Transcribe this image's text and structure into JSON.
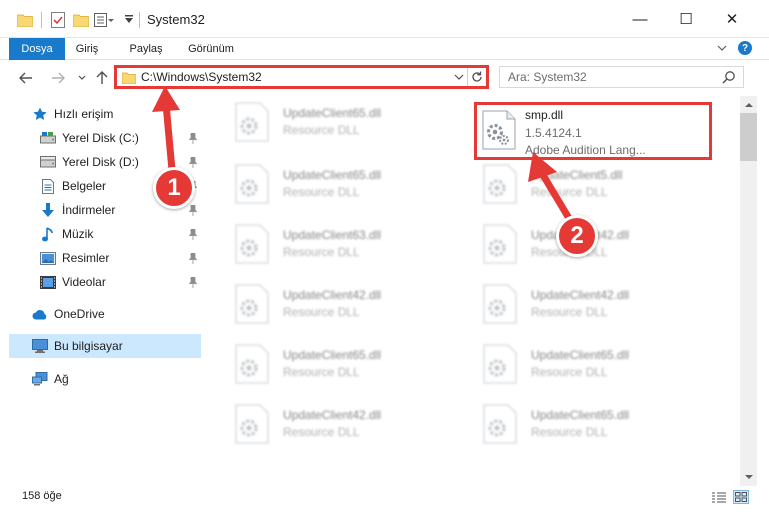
{
  "window": {
    "title": "System32",
    "minimize_glyph": "—",
    "maximize_glyph": "☐",
    "close_glyph": "✕"
  },
  "ribbon": {
    "tabs": [
      "Dosya",
      "Giriş",
      "Paylaş",
      "Görünüm"
    ],
    "help_glyph": "?"
  },
  "address": {
    "path": "C:\\Windows\\System32"
  },
  "search": {
    "placeholder": "Ara: System32"
  },
  "sidebar": {
    "items": [
      {
        "label": "Hızlı erişim",
        "icon": "star-icon"
      },
      {
        "label": "Yerel Disk (C:)",
        "icon": "drive-icon",
        "pinned": true
      },
      {
        "label": "Yerel Disk (D:)",
        "icon": "drive-icon",
        "pinned": true
      },
      {
        "label": "Belgeler",
        "icon": "document-icon",
        "pinned": true
      },
      {
        "label": "İndirmeler",
        "icon": "download-icon",
        "pinned": true
      },
      {
        "label": "Müzik",
        "icon": "music-icon",
        "pinned": true
      },
      {
        "label": "Resimler",
        "icon": "picture-icon",
        "pinned": true
      },
      {
        "label": "Videolar",
        "icon": "video-icon",
        "pinned": true
      },
      {
        "label": "OneDrive",
        "icon": "cloud-icon"
      },
      {
        "label": "Bu bilgisayar",
        "icon": "computer-icon",
        "selected": true
      },
      {
        "label": "Ağ",
        "icon": "network-icon"
      }
    ]
  },
  "files": [
    {
      "name": "UpdateClient65.dll",
      "desc": "Resource DLL"
    },
    {
      "name": "smp.dll",
      "desc": "1.5.4124.1",
      "desc2": "Adobe Audition Lang..."
    },
    {
      "name": "UpdateClient65.dll",
      "desc": "Resource DLL"
    },
    {
      "name": "UpdateClient5.dll",
      "desc": "Resource DLL"
    },
    {
      "name": "UpdateClient63.dll",
      "desc": "Resource DLL"
    },
    {
      "name": "UpdateClient42.dll",
      "desc": "Resource DLL"
    },
    {
      "name": "UpdateClient42.dll",
      "desc": "Resource DLL"
    },
    {
      "name": "UpdateClient42.dll",
      "desc": "Resource DLL"
    },
    {
      "name": "UpdateClient65.dll",
      "desc": "Resource DLL"
    },
    {
      "name": "UpdateClient65.dll",
      "desc": "Resource DLL"
    },
    {
      "name": "UpdateClient42.dll",
      "desc": "Resource DLL"
    },
    {
      "name": "UpdateClient65.dll",
      "desc": "Resource DLL"
    }
  ],
  "status": {
    "count": "158 öğe"
  },
  "annotations": {
    "marker1": "1",
    "marker2": "2",
    "color": "#e53935"
  },
  "colors": {
    "accent": "#1979ca",
    "highlight": "#e53935",
    "selection": "#cce8ff"
  }
}
